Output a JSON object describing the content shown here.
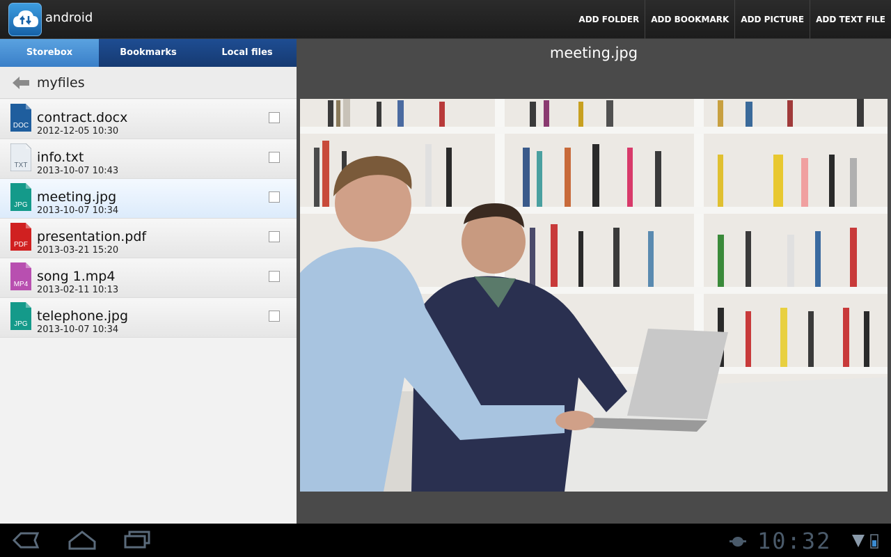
{
  "app": {
    "title": "android",
    "icon": "storebox-cloud-icon"
  },
  "actions": [
    {
      "label": "ADD FOLDER"
    },
    {
      "label": "ADD BOOKMARK"
    },
    {
      "label": "ADD PICTURE"
    },
    {
      "label": "ADD TEXT FILE"
    }
  ],
  "tabs": [
    {
      "label": "Storebox",
      "active": true
    },
    {
      "label": "Bookmarks",
      "active": false
    },
    {
      "label": "Local files",
      "active": false
    }
  ],
  "breadcrumb": {
    "folder": "myfiles"
  },
  "files": [
    {
      "name": "contract.docx",
      "date": "2012-12-05 10:30",
      "type": "DOC",
      "color": "#1f5e9e",
      "selected": false
    },
    {
      "name": "info.txt",
      "date": "2013-10-07 10:43",
      "type": "TXT",
      "color": "#e8edf2",
      "selected": false
    },
    {
      "name": "meeting.jpg",
      "date": "2013-10-07 10:34",
      "type": "JPG",
      "color": "#149a8a",
      "selected": true
    },
    {
      "name": "presentation.pdf",
      "date": "2013-03-21 15:20",
      "type": "PDF",
      "color": "#d02020",
      "selected": false
    },
    {
      "name": "song 1.mp4",
      "date": "2013-02-11 10:13",
      "type": "MP4",
      "color": "#b84fb0",
      "selected": false
    },
    {
      "name": "telephone.jpg",
      "date": "2013-10-07 10:34",
      "type": "JPG",
      "color": "#149a8a",
      "selected": false
    }
  ],
  "preview": {
    "title": "meeting.jpg"
  },
  "statusbar": {
    "time": "10:32"
  }
}
